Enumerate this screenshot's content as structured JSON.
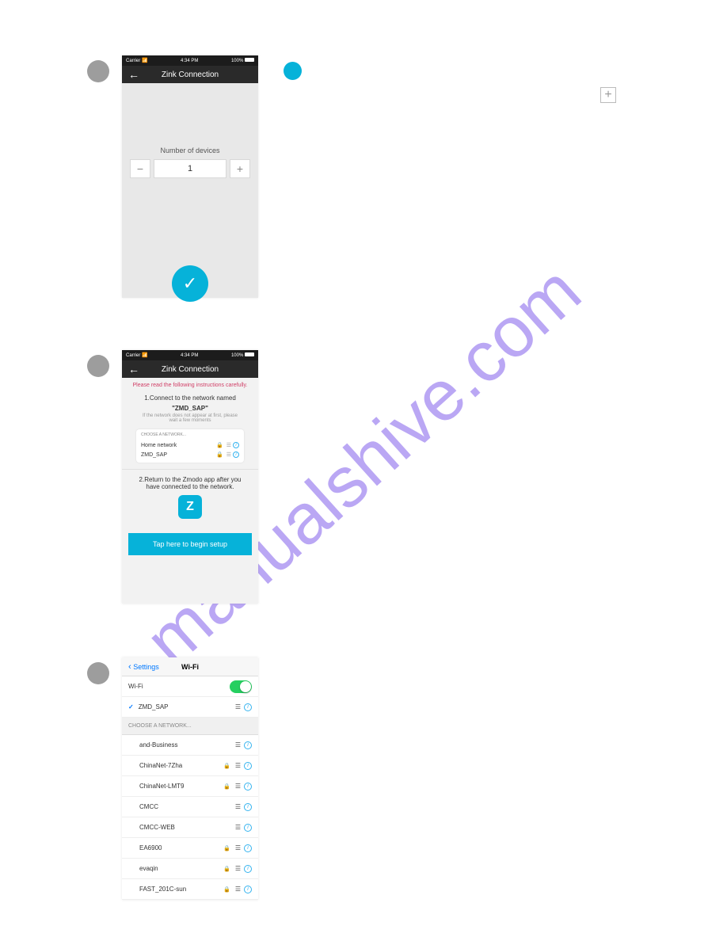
{
  "watermark": "manualshive.com",
  "status": {
    "carrier": "Carrier",
    "time": "4:34 PM",
    "battery": "100%"
  },
  "screen1": {
    "title": "Zink Connection",
    "label": "Number of devices",
    "value": "1"
  },
  "screen2": {
    "title": "Zink Connection",
    "warn": "Please read the following instructions carefully.",
    "step1a": "1.Connect to the network named",
    "step1b": "\"ZMD_SAP\"",
    "step1sub": "If the network does not appear at first, please wait a few moments",
    "choose": "CHOOSE A NETWORK...",
    "nets": [
      {
        "name": "Home network"
      },
      {
        "name": "ZMD_SAP"
      }
    ],
    "step2": "2.Return to the Zmodo app after you have connected to the network.",
    "button": "Tap here to begin setup"
  },
  "wifi": {
    "back": "Settings",
    "title": "Wi-Fi",
    "toggleLabel": "Wi-Fi",
    "connected": "ZMD_SAP",
    "choose": "CHOOSE A NETWORK...",
    "list": [
      {
        "ssid": "and-Business",
        "locked": false
      },
      {
        "ssid": "ChinaNet-7Zha",
        "locked": true
      },
      {
        "ssid": "ChinaNet-LMT9",
        "locked": true
      },
      {
        "ssid": "CMCC",
        "locked": false
      },
      {
        "ssid": "CMCC-WEB",
        "locked": false
      },
      {
        "ssid": "EA6900",
        "locked": true
      },
      {
        "ssid": "evaqin",
        "locked": true
      },
      {
        "ssid": "FAST_201C-sun",
        "locked": true
      }
    ]
  }
}
